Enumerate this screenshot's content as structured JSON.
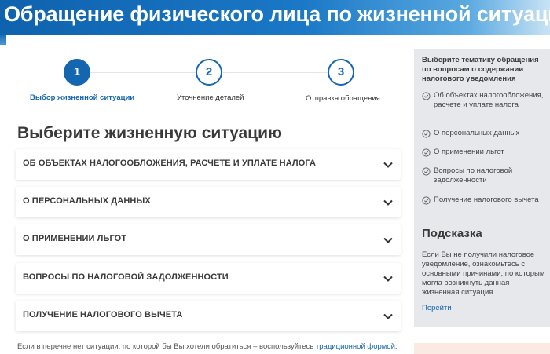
{
  "header": {
    "title": "Обращение физического лица по жизненной ситуации"
  },
  "steps": [
    {
      "number": "1",
      "label": "Выбор жизненной ситуации",
      "active": true
    },
    {
      "number": "2",
      "label": "Уточнение деталей",
      "active": false
    },
    {
      "number": "3",
      "label": "Отправка обращения",
      "active": false
    }
  ],
  "main": {
    "heading": "Выберите жизненную ситуацию",
    "accordion": [
      "ОБ ОБЪЕКТАХ НАЛОГООБЛОЖЕНИЯ, РАСЧЕТЕ И УПЛАТЕ НАЛОГА",
      "О ПЕРСОНАЛЬНЫХ ДАННЫХ",
      "О ПРИМЕНЕНИИ ЛЬГОТ",
      "ВОПРОСЫ ПО НАЛОГОВОЙ ЗАДОЛЖЕННОСТИ",
      "ПОЛУЧЕНИЕ НАЛОГОВОГО ВЫЧЕТА"
    ],
    "footer_text": "Если в перечне нет ситуации, по которой бы Вы хотели обратиться – воспользуйтесь ",
    "footer_link": "традиционной формой",
    "footer_end": "."
  },
  "side": {
    "intro": "Выберите тематику обращения по вопросам о содержании налогового уведомления",
    "items": [
      "Об объектах налогообложения, расчете и уплате налога",
      "О персональных данных",
      "О применении льгот",
      "Вопросы по налоговой задолженности",
      "Получение налогового вычета"
    ],
    "hint_title": "Подсказка",
    "hint_text": "Если Вы не получили налоговое уведомление, ознакомьтесь с основными причинами, по которым могла возникнуть данная жизненная ситуация.",
    "hint_link": "Перейти"
  },
  "colors": {
    "brand": "#1566b0",
    "panel": "#e6e8ec"
  }
}
